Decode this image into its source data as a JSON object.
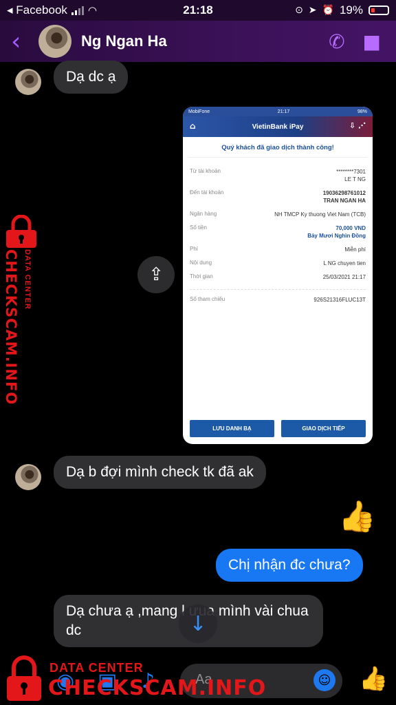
{
  "status_bar": {
    "carrier": "◂ Facebook",
    "time": "21:18",
    "battery": "19%"
  },
  "header": {
    "contact_name": "Ng Ngan Ha"
  },
  "messages": [
    {
      "text": "Dạ dc ạ"
    },
    {
      "text": "Dạ b đợi mình check tk đã ak"
    },
    {
      "text": "Chị nhận đc chưa?"
    },
    {
      "text": "Dạ chưa ạ ,mang l  ưua mình vài chua dc"
    }
  ],
  "receipt": {
    "status_left": "MobiFone",
    "status_time": "21:17",
    "status_right": "98%",
    "app_title": "VietinBank iPay",
    "success_text": "Quý khách đã giao dịch thành công!",
    "rows": [
      {
        "label": "Từ tài khoản",
        "value": "********7301",
        "value2": "LE T            NG"
      },
      {
        "label": "Đến tài khoản",
        "value": "19036298761012",
        "value2": "TRAN NGAN HA"
      },
      {
        "label": "Ngân hàng",
        "value": "NH TMCP Ky thuong Viet Nam (TCB)",
        "value2": ""
      },
      {
        "label": "Số tiền",
        "value": "70,000 VND",
        "value2": "Bảy Mươi Nghìn Đồng"
      },
      {
        "label": "Phí",
        "value": "Miễn phí",
        "value2": ""
      },
      {
        "label": "Nội dung",
        "value": "L            NG chuyen tien",
        "value2": ""
      },
      {
        "label": "Thời gian",
        "value": "25/03/2021 21:17",
        "value2": ""
      }
    ],
    "reference_label": "Số tham chiếu",
    "reference_value": "926S21316FLUC13T",
    "btn_save": "LƯU DANH BẠ",
    "btn_continue": "GIAO DỊCH TIẾP"
  },
  "composer": {
    "placeholder": "Aa"
  },
  "watermark": {
    "small": "DATA CENTER",
    "big": "CHECKSCAM.INFO"
  },
  "colors": {
    "accent": "#1877f2",
    "header_icon": "#b86bff",
    "watermark": "#e3161a"
  }
}
